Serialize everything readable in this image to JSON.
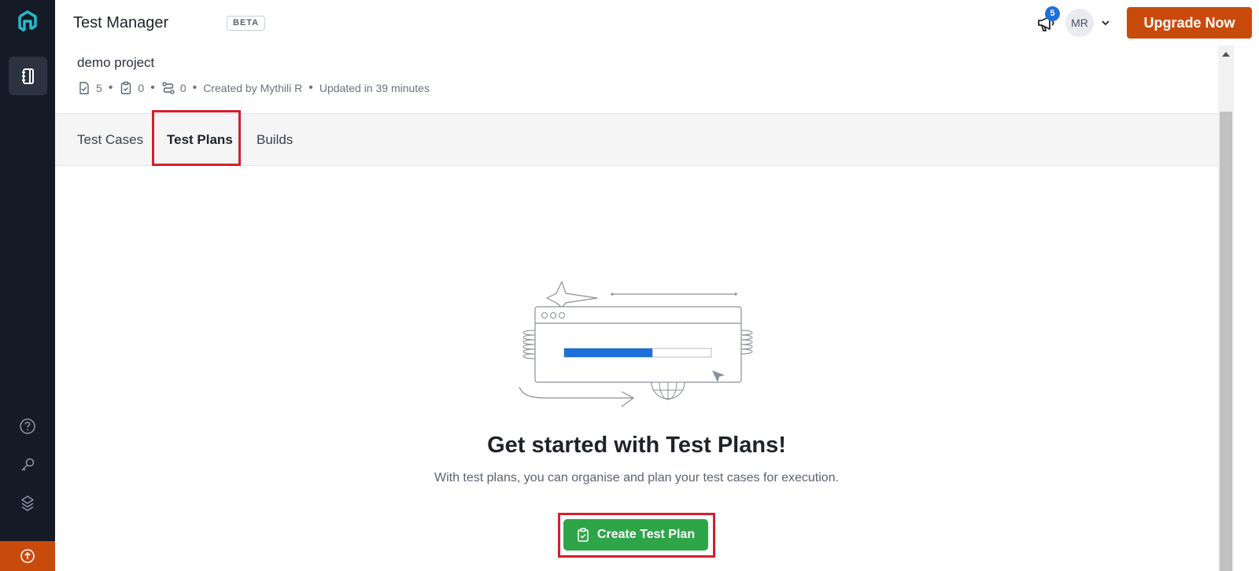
{
  "header": {
    "app_title": "Test Manager",
    "beta_badge": "BETA",
    "notification_count": "5",
    "avatar_initials": "MR",
    "upgrade_label": "Upgrade Now"
  },
  "project": {
    "name": "demo project",
    "test_cases_count": "5",
    "test_plans_count": "0",
    "builds_count": "0",
    "created_by": "Created by Mythili R",
    "updated": "Updated in 39 minutes"
  },
  "tabs": [
    {
      "label": "Test Cases"
    },
    {
      "label": "Test Plans",
      "active": true
    },
    {
      "label": "Builds"
    }
  ],
  "empty_state": {
    "title": "Get started with Test Plans!",
    "description": "With test plans, you can organise and plan your test cases for execution.",
    "button_label": "Create Test Plan",
    "progress": 0.6
  },
  "sidebar": {
    "icons": [
      "logo-icon",
      "test-manager-icon",
      "help-icon",
      "key-icon",
      "integrations-icon",
      "upload-icon"
    ]
  },
  "colors": {
    "rail_bg": "#141a26",
    "upgrade_bg": "#c94b0b",
    "create_bg": "#2fa54a",
    "highlight": "#d41f2e",
    "progress_fill": "#1e6fd9"
  }
}
